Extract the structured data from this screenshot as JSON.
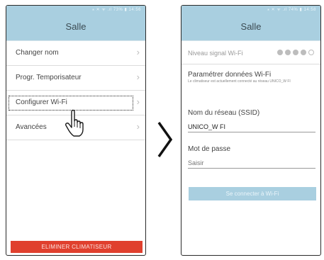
{
  "left_screen": {
    "status_text": "⁎ ✕ ᯤ .ıl 73% ▮ 14:56",
    "title": "Salle",
    "menu": [
      {
        "label": "Changer nom",
        "chevron": "›"
      },
      {
        "label": "Progr. Temporisateur",
        "chevron": "›"
      },
      {
        "label": "Configurer Wi-Fi",
        "chevron": "›"
      },
      {
        "label": "Avancées",
        "chevron": "›"
      }
    ],
    "delete_button": "ELIMINER CLIMATISEUR"
  },
  "right_screen": {
    "status_text": "⁎ ✕ ᯤ .ıl 74% ▮ 14:58",
    "title": "Salle",
    "signal": {
      "label": "Niveau signal Wi-Fi",
      "level": 4,
      "max": 5
    },
    "wifi_title": "Paramétrer données Wi-Fi",
    "wifi_subtitle": "Le climatiseur est actuellement connecté au réseau UNICO_W FI",
    "ssid_label": "Nom du réseau (SSID)",
    "ssid_value": "UNICO_W FI",
    "password_label": "Mot de passe",
    "password_placeholder": "Saisir",
    "connect_button": "Se connecter à Wi-Fi"
  },
  "icons": {
    "transition_arrow": "chevron-right-icon",
    "pointer": "hand-pointer-icon"
  },
  "colors": {
    "header": "#a9cfe0",
    "delete": "#e0402e",
    "border": "#2a2a2a"
  }
}
